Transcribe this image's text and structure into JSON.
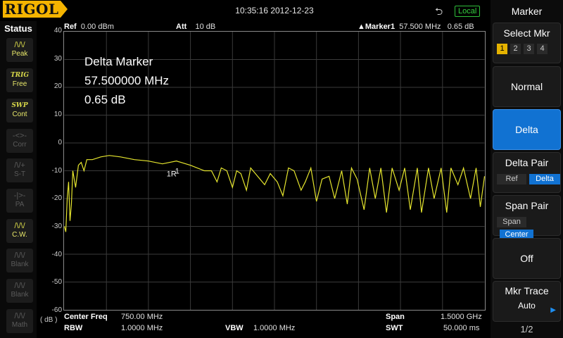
{
  "brand": "RIGOL",
  "datetime": "10:35:16 2012-12-23",
  "remote_status": "Local",
  "status_panel": {
    "title": "Status",
    "items": [
      {
        "glyph": "/\\/\\/",
        "label": "Peak",
        "state": "on"
      },
      {
        "glyph": "TRIG",
        "label": "Free",
        "state": "on"
      },
      {
        "glyph": "SWP",
        "label": "Cont",
        "state": "on"
      },
      {
        "glyph": "-<>-",
        "label": "Corr",
        "state": "off"
      },
      {
        "glyph": "/\\/+",
        "label": "S-T",
        "state": "off"
      },
      {
        "glyph": "-|>-",
        "label": "PA",
        "state": "off"
      },
      {
        "glyph": "/\\/\\/",
        "label": "C.W.",
        "state": "on"
      },
      {
        "glyph": "/\\/\\/",
        "label": "Blank",
        "state": "off"
      },
      {
        "glyph": "/\\/\\/",
        "label": "Blank",
        "state": "off"
      },
      {
        "glyph": "/\\/\\/",
        "label": "Math",
        "state": "off"
      }
    ]
  },
  "header": {
    "ref_label": "Ref",
    "ref_value": "0.00 dBm",
    "att_label": "Att",
    "att_value": "10 dB",
    "marker_label": "▲Marker1",
    "marker_freq": "57.500 MHz",
    "marker_amp": "0.65 dB"
  },
  "annotation": {
    "line1": "Delta Marker",
    "line2": "57.500000 MHz",
    "line3": "0.65 dB"
  },
  "y_unit": "( dB )",
  "footer": {
    "center_label": "Center Freq",
    "center_value": "750.00 MHz",
    "span_label": "Span",
    "span_value": "1.5000 GHz",
    "rbw_label": "RBW",
    "rbw_value": "1.0000 MHz",
    "vbw_label": "VBW",
    "vbw_value": "1.0000 MHz",
    "swt_label": "SWT",
    "swt_value": "50.000 ms"
  },
  "chart_data": {
    "type": "line",
    "trace_color": "#e6e62e",
    "ylim": [
      -60,
      40
    ],
    "y_ticks": [
      "40",
      "30",
      "20",
      "10",
      "0",
      "-10",
      "-20",
      "-30",
      "-40",
      "-50",
      "-60"
    ],
    "x_range_mhz": [
      0,
      1500
    ],
    "grid": true,
    "marker_labels": [
      "1R",
      "1"
    ],
    "series": [
      {
        "x": [
          0,
          5,
          10,
          15,
          20,
          25,
          30,
          40,
          50,
          60,
          70,
          80,
          100,
          130,
          160,
          200,
          250,
          300,
          350,
          400,
          450,
          500,
          525,
          545,
          560,
          580,
          600,
          615,
          630,
          650,
          665,
          690,
          715,
          735,
          760,
          780,
          800,
          820,
          845,
          860,
          880,
          900,
          920,
          945,
          965,
          990,
          1010,
          1025,
          1045,
          1070,
          1090,
          1110,
          1130,
          1150,
          1170,
          1195,
          1215,
          1235,
          1260,
          1275,
          1300,
          1320,
          1345,
          1365,
          1380,
          1405,
          1425,
          1450,
          1470,
          1485,
          1500
        ],
        "y": [
          -30,
          -32,
          -20,
          -14,
          -28,
          -22,
          -10,
          -16,
          -8,
          -7,
          -10,
          -6,
          -6,
          -5,
          -4.5,
          -5,
          -6,
          -6.5,
          -7.5,
          -6.5,
          -8,
          -10,
          -10,
          -14,
          -9,
          -10,
          -16,
          -10,
          -11,
          -17,
          -9,
          -12,
          -15,
          -11,
          -14,
          -19,
          -9,
          -10,
          -17,
          -14,
          -9,
          -21,
          -13,
          -12,
          -20,
          -10,
          -22,
          -9,
          -13,
          -24,
          -9,
          -20,
          -9,
          -25,
          -9,
          -17,
          -9,
          -24,
          -9,
          -25,
          -9,
          -20,
          -9,
          -25,
          -9,
          -15,
          -9,
          -20,
          -9,
          -23,
          -12
        ]
      }
    ]
  },
  "right_panel": {
    "title": "Marker",
    "select_mkr": {
      "label": "Select Mkr",
      "options": [
        "1",
        "2",
        "3",
        "4"
      ],
      "selected": "1"
    },
    "normal": "Normal",
    "delta": "Delta",
    "delta_pair": {
      "label": "Delta Pair",
      "options": [
        "Ref",
        "Delta"
      ],
      "selected": "Delta"
    },
    "span_pair": {
      "label": "Span Pair",
      "options": [
        "Span",
        "Center"
      ],
      "selected": "Center"
    },
    "off": "Off",
    "mkr_trace": {
      "label": "Mkr Trace",
      "value": "Auto"
    },
    "page": "1/2"
  }
}
